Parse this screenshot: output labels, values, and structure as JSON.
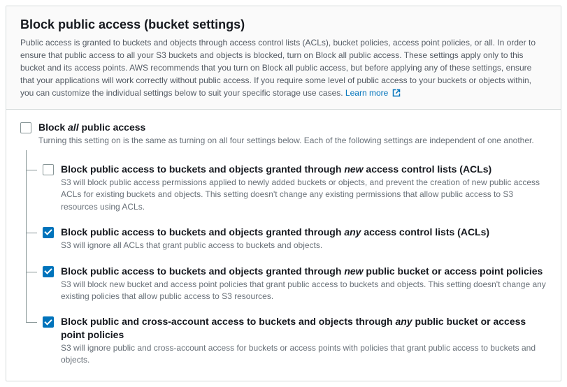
{
  "panel": {
    "title": "Block public access (bucket settings)",
    "description": "Public access is granted to buckets and objects through access control lists (ACLs), bucket policies, access point policies, or all. In order to ensure that public access to all your S3 buckets and objects is blocked, turn on Block all public access. These settings apply only to this bucket and its access points. AWS recommends that you turn on Block all public access, but before applying any of these settings, ensure that your applications will work correctly without public access. If you require some level of public access to your buckets or objects within, you can customize the individual settings below to suit your specific storage use cases.",
    "learn_more": "Learn more"
  },
  "master": {
    "checked": false,
    "title_pre": "Block ",
    "title_em": "all",
    "title_post": " public access",
    "desc": "Turning this setting on is the same as turning on all four settings below. Each of the following settings are independent of one another."
  },
  "items": [
    {
      "checked": false,
      "title_pre": "Block public access to buckets and objects granted through ",
      "title_em": "new",
      "title_post": " access control lists (ACLs)",
      "desc": "S3 will block public access permissions applied to newly added buckets or objects, and prevent the creation of new public access ACLs for existing buckets and objects. This setting doesn't change any existing permissions that allow public access to S3 resources using ACLs."
    },
    {
      "checked": true,
      "title_pre": "Block public access to buckets and objects granted through ",
      "title_em": "any",
      "title_post": " access control lists (ACLs)",
      "desc": "S3 will ignore all ACLs that grant public access to buckets and objects."
    },
    {
      "checked": true,
      "title_pre": "Block public access to buckets and objects granted through ",
      "title_em": "new",
      "title_post": " public bucket or access point policies",
      "desc": "S3 will block new bucket and access point policies that grant public access to buckets and objects. This setting doesn't change any existing policies that allow public access to S3 resources."
    },
    {
      "checked": true,
      "title_pre": "Block public and cross-account access to buckets and objects through ",
      "title_em": "any",
      "title_post": " public bucket or access point policies",
      "desc": "S3 will ignore public and cross-account access for buckets or access points with policies that grant public access to buckets and objects."
    }
  ]
}
